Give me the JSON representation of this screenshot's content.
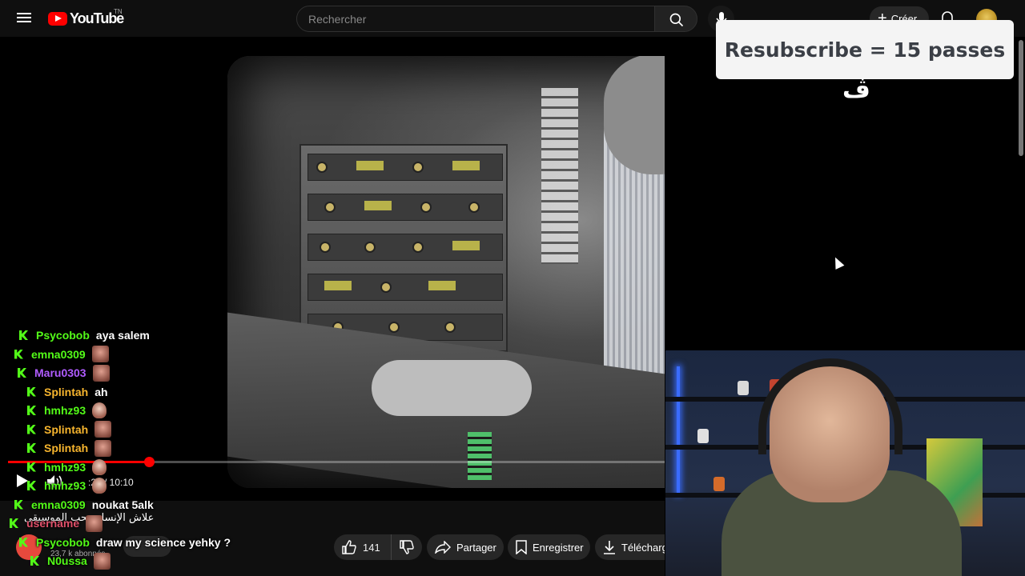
{
  "header": {
    "logo_text": "YouTube",
    "country_code": "TN",
    "search_placeholder": "Rechercher",
    "create_label": "Créer"
  },
  "overlay": {
    "card_text": "Resubscribe = 15 passes",
    "brand_glyph": "ڤ"
  },
  "player": {
    "time_current": ":21",
    "time_total": "10:10",
    "time_display": ":21 / 10:10",
    "progress_fraction": 0.215
  },
  "video_meta": {
    "title": "علاش الإنسان يحب الموسيقى",
    "channel_subs": "23,7 k abonnés",
    "like_count": "141",
    "share_label": "Partager",
    "save_label": "Enregistrer",
    "download_label": "Télécharger"
  },
  "chat": [
    {
      "user": "Psycobob",
      "color": "#53fc18",
      "msg": "aya salem",
      "emote": ""
    },
    {
      "user": "emna0309",
      "color": "#53fc18",
      "msg": "",
      "emote": "face"
    },
    {
      "user": "Maru0303",
      "color": "#b05cff",
      "msg": "",
      "emote": "face"
    },
    {
      "user": "Splintah",
      "color": "#f7b52e",
      "msg": "ah",
      "emote": ""
    },
    {
      "user": "hmhz93",
      "color": "#53fc18",
      "msg": "",
      "emote": "small"
    },
    {
      "user": "Splintah",
      "color": "#f7b52e",
      "msg": "",
      "emote": "face"
    },
    {
      "user": "Splintah",
      "color": "#f7b52e",
      "msg": "",
      "emote": "face"
    },
    {
      "user": "hmhz93",
      "color": "#53fc18",
      "msg": "",
      "emote": "small"
    },
    {
      "user": "hmhz93",
      "color": "#53fc18",
      "msg": "",
      "emote": "small"
    },
    {
      "user": "emna0309",
      "color": "#53fc18",
      "msg": "noukat 5alk",
      "emote": ""
    },
    {
      "user": "username",
      "color": "#e0506a",
      "msg": "",
      "emote": "face"
    },
    {
      "user": "Psycobob",
      "color": "#53fc18",
      "msg": "draw my science yehky ?",
      "emote": ""
    },
    {
      "user": "N0ussa",
      "color": "#53fc18",
      "msg": "",
      "emote": "face"
    }
  ],
  "colors": {
    "accent_red": "#ff0000",
    "kick_green": "#53fc18",
    "pill_bg": "#272727",
    "card_bg": "#f4f4f4"
  }
}
